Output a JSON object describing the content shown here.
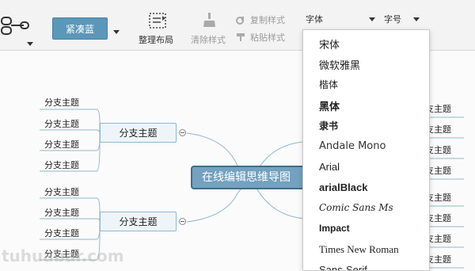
{
  "toolbar": {
    "theme_label": "紧凑蓝",
    "arrange_label": "整理布局",
    "clear_style_label": "清除样式",
    "copy_style_label": "复制样式",
    "paste_style_label": "粘贴样式",
    "font_family_label": "字体",
    "font_size_label": "字号"
  },
  "mindmap": {
    "center_label": "在线编辑思维导图",
    "branch_top": "分支主题",
    "branch_bottom": "分支主题",
    "left_leaves": [
      "分支主题",
      "分支主题",
      "分支主题",
      "分支主题",
      "分支主题",
      "分支主题",
      "分支主题",
      "分支主题"
    ],
    "right_leaves": [
      "分支主题",
      "分支主题",
      "分支主题",
      "分支主题",
      "分支主题",
      "分支主题",
      "分支主题",
      "分支主题"
    ]
  },
  "font_menu": {
    "options": [
      "宋体",
      "微软雅黑",
      "楷体",
      "黑体",
      "隶书",
      "Andale Mono",
      "Arial",
      "arialBlack",
      "Comic Sans Ms",
      "Impact",
      "Times New Roman",
      "Sans-Serif"
    ]
  },
  "watermark": "tuhuabar.com",
  "colors": {
    "theme_button": "#5b97b9",
    "center_node": "#73a1bf",
    "branch_border": "#8fb8d0",
    "line": "#8fb8c8"
  }
}
